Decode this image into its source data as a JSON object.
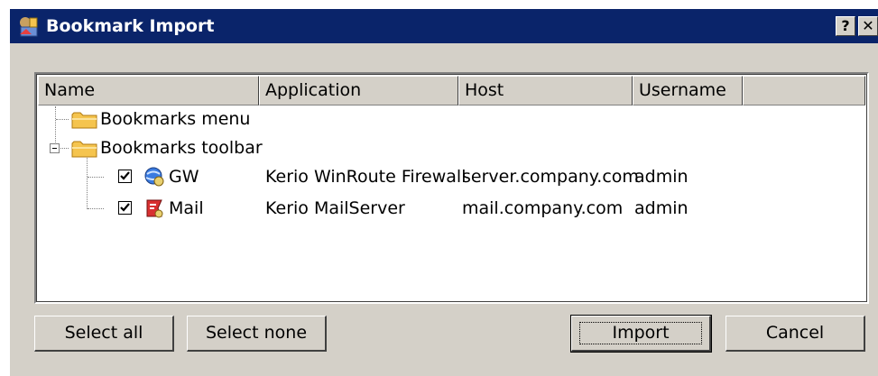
{
  "window": {
    "title": "Bookmark Import",
    "help_label": "?",
    "close_label": "✕"
  },
  "list": {
    "columns": [
      "Name",
      "Application",
      "Host",
      "Username"
    ],
    "tree": {
      "folder_menu": "Bookmarks menu",
      "folder_toolbar": "Bookmarks toolbar",
      "items": [
        {
          "name": "GW",
          "application": "Kerio WinRoute Firewall",
          "host": "server.company.com",
          "username": "admin",
          "checked": true
        },
        {
          "name": "Mail",
          "application": "Kerio MailServer",
          "host": "mail.company.com",
          "username": "admin",
          "checked": true
        }
      ]
    }
  },
  "buttons": {
    "select_all": "Select all",
    "select_none": "Select none",
    "import": "Import",
    "cancel": "Cancel"
  },
  "colors": {
    "titlebar": "#0a246a",
    "face": "#d4d0c8",
    "folder": "#f5c44e"
  }
}
